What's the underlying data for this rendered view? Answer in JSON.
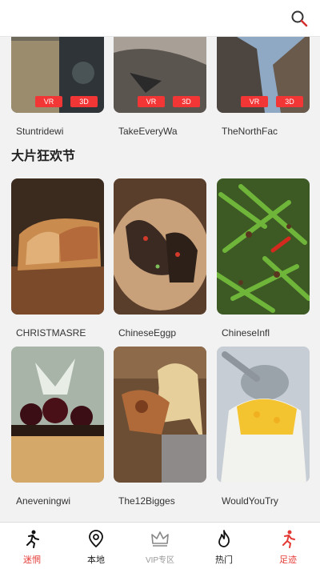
{
  "header": {
    "search_icon": "search-icon"
  },
  "top_row": [
    {
      "caption": "Stuntridewi",
      "badges": [
        "VR",
        "3D"
      ]
    },
    {
      "caption": "TakeEveryWa",
      "badges": [
        "VR",
        "3D"
      ]
    },
    {
      "caption": "TheNorthFac",
      "badges": [
        "VR",
        "3D"
      ]
    }
  ],
  "section": {
    "title": "大片狂欢节",
    "cards": [
      {
        "caption": "CHRISTMASRE"
      },
      {
        "caption": "ChineseEggp"
      },
      {
        "caption": "ChineseInfl"
      },
      {
        "caption": "Aneveningwi"
      },
      {
        "caption": "The12Bigges"
      },
      {
        "caption": "WouldYouTry"
      }
    ]
  },
  "bottom_nav": [
    {
      "label": "迷惘",
      "icon": "runner-icon",
      "active": true
    },
    {
      "label": "本地",
      "icon": "location-pin-icon",
      "active": false
    },
    {
      "label": "VIP专区",
      "icon": "crown-icon",
      "active": false
    },
    {
      "label": "热门",
      "icon": "flame-icon",
      "active": false
    },
    {
      "label": "足迹",
      "icon": "footprint-runner-icon",
      "active": true
    }
  ],
  "colors": {
    "accent": "#e53935",
    "badge": "#f23535",
    "background": "#f2f2f2"
  }
}
